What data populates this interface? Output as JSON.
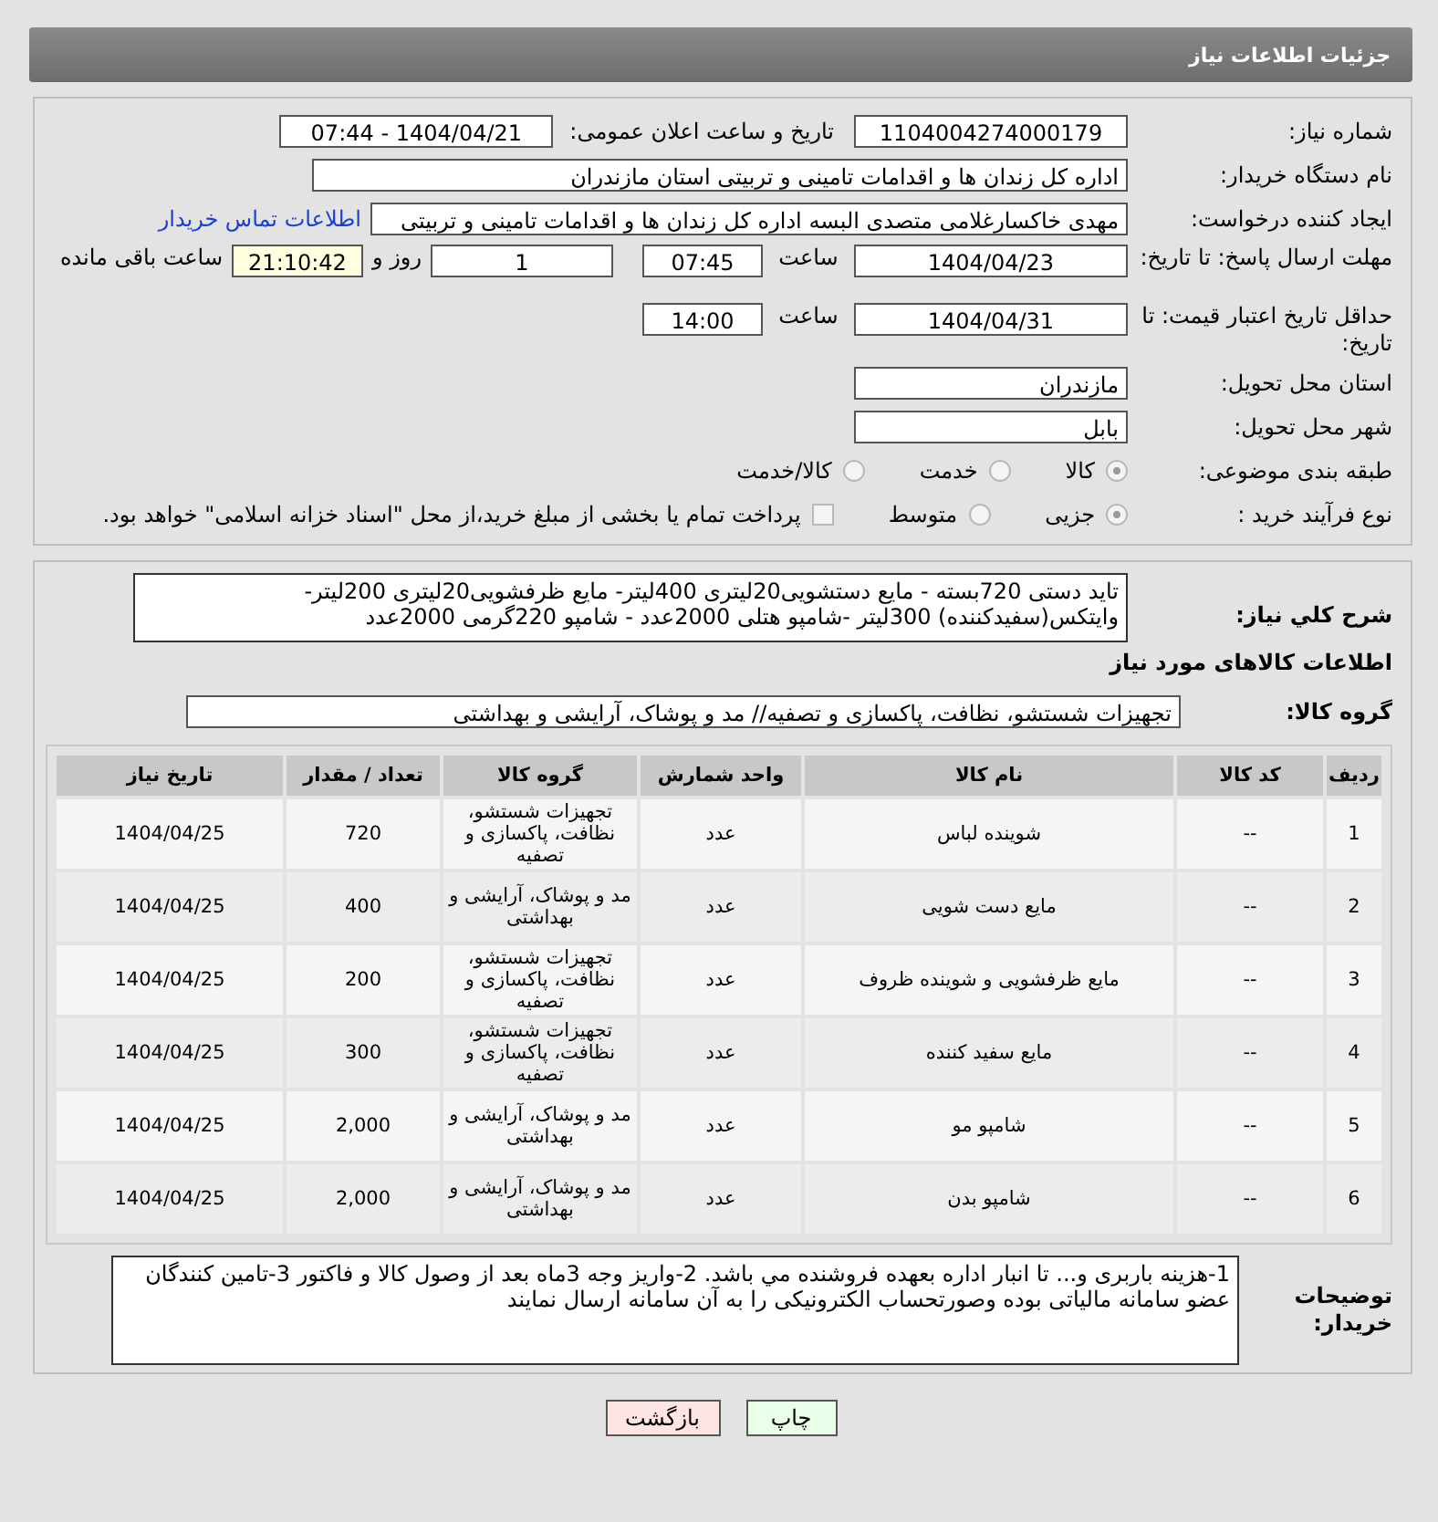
{
  "header": {
    "title": "جزئیات اطلاعات نیاز"
  },
  "need_number": {
    "label": "شماره نیاز:",
    "value": "1104004274000179"
  },
  "announce": {
    "label": "تاریخ و ساعت اعلان عمومی:",
    "value": "1404/04/21 - 07:44"
  },
  "buyer_org": {
    "label": "نام دستگاه خریدار:",
    "value": "اداره کل زندان ها و اقدامات تامینی و تربیتی استان مازندران"
  },
  "requester": {
    "label": "ایجاد کننده درخواست:",
    "value": "مهدی خاکسارغلامی متصدی البسه اداره کل زندان ها و اقدامات تامینی و تربیتی",
    "link": "اطلاعات تماس خریدار"
  },
  "deadline": {
    "label": "مهلت ارسال پاسخ: تا تاریخ:",
    "date": "1404/04/23",
    "time_label": "ساعت",
    "time": "07:45",
    "days": "1",
    "days_label": "روز و",
    "remaining": "21:10:42",
    "remaining_label": "ساعت باقی مانده"
  },
  "validity": {
    "label": "حداقل تاریخ اعتبار قیمت: تا تاریخ:",
    "date": "1404/04/31",
    "time_label": "ساعت",
    "time": "14:00"
  },
  "province": {
    "label": "استان محل تحویل:",
    "value": "مازندران"
  },
  "city": {
    "label": "شهر محل تحویل:",
    "value": "بابل"
  },
  "category": {
    "label": "طبقه بندی موضوعی:",
    "options": [
      {
        "label": "کالا",
        "selected": true
      },
      {
        "label": "خدمت",
        "selected": false
      },
      {
        "label": "کالا/خدمت",
        "selected": false
      }
    ]
  },
  "process": {
    "label": "نوع فرآیند خرید :",
    "options": [
      {
        "label": "جزیی",
        "selected": true
      },
      {
        "label": "متوسط",
        "selected": false
      }
    ],
    "treasury": {
      "label": "پرداخت تمام یا بخشی از مبلغ خرید،از محل \"اسناد خزانه اسلامی\" خواهد بود.",
      "checked": false
    }
  },
  "description": {
    "label": "شرح کلي نياز:",
    "value": "تاید دستی 720بسته - مایع دستشویی20لیتری 400لیتر- مایع ظرفشویی20لیتری 200لیتر-وایتکس(سفیدکننده) 300لیتر -شامپو هتلی 2000عدد - شامپو 220گرمی 2000عدد"
  },
  "goods_title": "اطلاعات کالاهای مورد نیاز",
  "goods_group": {
    "label": "گروه کالا:",
    "value": "تجهیزات شستشو، نظافت، پاکسازی و تصفیه// مد و پوشاک، آرایشی و بهداشتی"
  },
  "table": {
    "columns": [
      "ردیف",
      "کد کالا",
      "نام کالا",
      "واحد شمارش",
      "گروه کالا",
      "تعداد / مقدار",
      "تاریخ نیاز"
    ],
    "rows": [
      [
        "1",
        "--",
        "شوینده لباس",
        "عدد",
        "تجهیزات شستشو، نظافت، پاکسازی و تصفیه",
        "720",
        "1404/04/25"
      ],
      [
        "2",
        "--",
        "مایع دست شویی",
        "عدد",
        "مد و پوشاک، آرایشی و بهداشتی",
        "400",
        "1404/04/25"
      ],
      [
        "3",
        "--",
        "مایع ظرفشویی و شوینده ظروف",
        "عدد",
        "تجهیزات شستشو، نظافت، پاکسازی و تصفیه",
        "200",
        "1404/04/25"
      ],
      [
        "4",
        "--",
        "مایع سفید کننده",
        "عدد",
        "تجهیزات شستشو، نظافت، پاکسازی و تصفیه",
        "300",
        "1404/04/25"
      ],
      [
        "5",
        "--",
        "شامپو مو",
        "عدد",
        "مد و پوشاک، آرایشی و بهداشتی",
        "2,000",
        "1404/04/25"
      ],
      [
        "6",
        "--",
        "شامپو بدن",
        "عدد",
        "مد و پوشاک، آرایشی و بهداشتی",
        "2,000",
        "1404/04/25"
      ]
    ]
  },
  "notes": {
    "label": "توضیحات خریدار:",
    "value": "1-هزینه باربری و... تا انبار اداره  بعهده فروشنده مي باشد. 2-واریز وجه 3ماه بعد از وصول کالا و فاکتور 3-تامین کنندگان عضو سامانه مالیاتی بوده وصورتحساب الکترونیکی را به آن سامانه ارسال نمایند"
  },
  "buttons": [
    {
      "label": "چاپ",
      "kind": "print"
    },
    {
      "label": "بازگشت",
      "kind": "back"
    }
  ]
}
